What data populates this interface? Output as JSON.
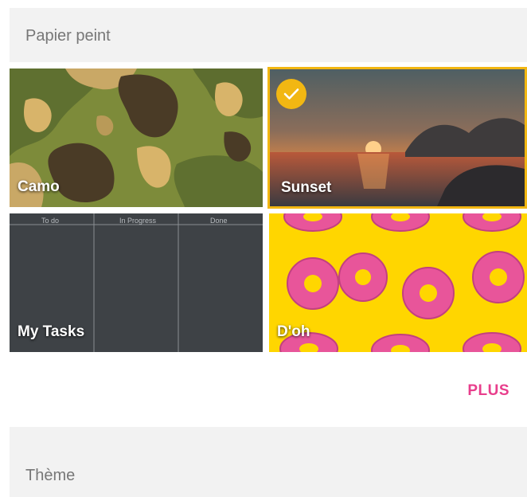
{
  "wallpaper_section": {
    "title": "Papier peint"
  },
  "tiles": [
    {
      "label": "Camo",
      "selected": false
    },
    {
      "label": "Sunset",
      "selected": true
    },
    {
      "label": "My Tasks",
      "selected": false,
      "columns": [
        "To do",
        "In Progress",
        "Done"
      ]
    },
    {
      "label": "D'oh",
      "selected": false
    }
  ],
  "more_button": {
    "label": "PLUS"
  },
  "theme_section": {
    "title": "Thème"
  },
  "colors": {
    "accent": "#e83e8c",
    "selection": "#f2b712"
  },
  "icons": {
    "selected_badge": "check-icon"
  }
}
